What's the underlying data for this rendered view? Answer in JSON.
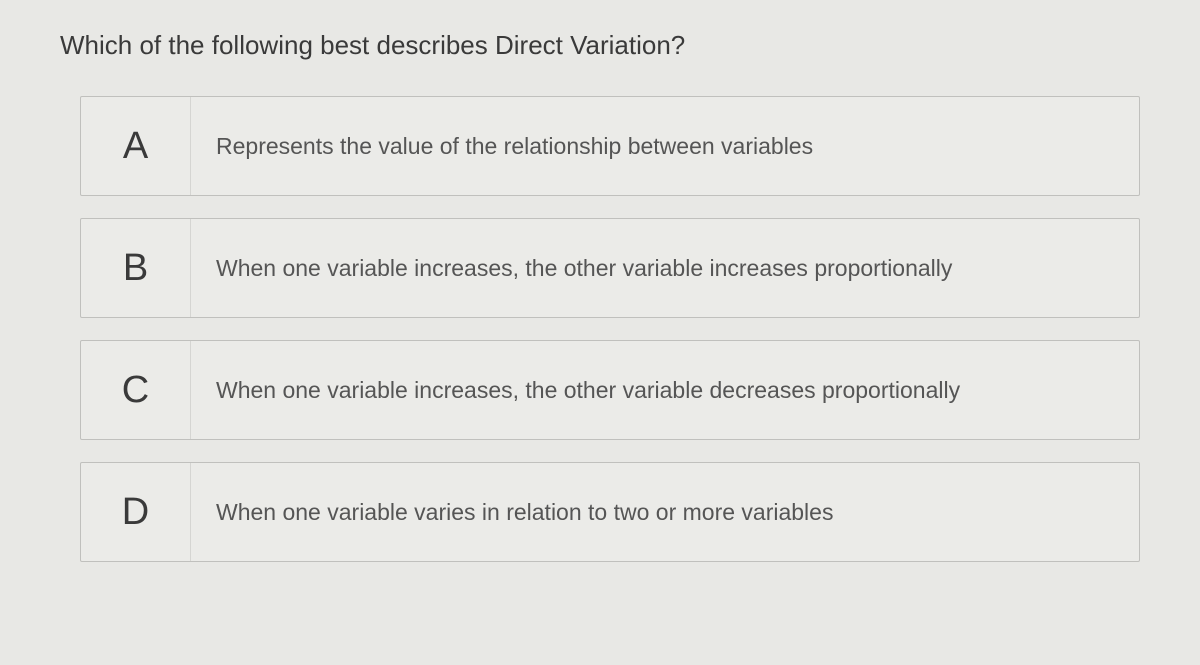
{
  "question": "Which of the following best describes Direct Variation?",
  "options": [
    {
      "letter": "A",
      "text": "Represents the value of the relationship between variables"
    },
    {
      "letter": "B",
      "text": "When one variable increases, the other variable increases proportionally"
    },
    {
      "letter": "C",
      "text": "When one variable increases, the other variable decreases proportionally"
    },
    {
      "letter": "D",
      "text": "When one variable varies in relation to two or more variables"
    }
  ]
}
